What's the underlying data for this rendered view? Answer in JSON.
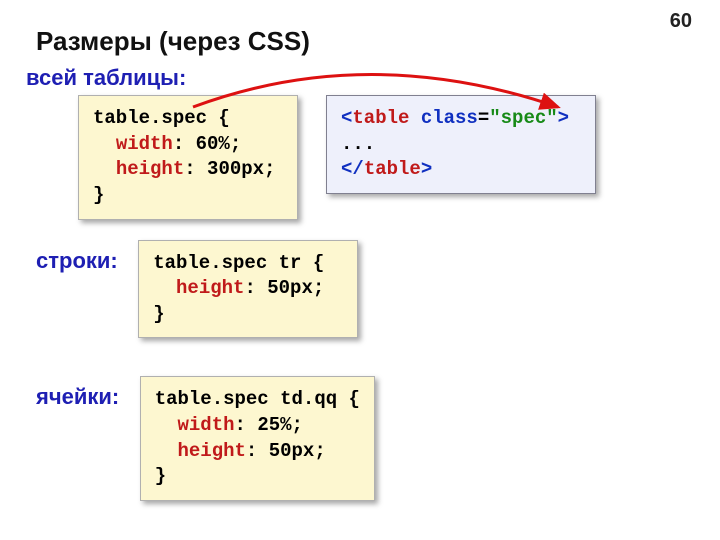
{
  "page_number": "60",
  "title": "Размеры (через CSS)",
  "labels": {
    "table": "всей таблицы:",
    "row": "строки:",
    "cell": "ячейки:"
  },
  "code": {
    "table_css": {
      "selector": "table.spec {",
      "width_key": "width",
      "width_val": ": 60%;",
      "height_key": "height",
      "height_val": ": 300px;",
      "close": "}"
    },
    "table_html": {
      "open_lt": "<",
      "open_tag": "table ",
      "attr": "class",
      "eq": "=",
      "val": "\"spec\"",
      "open_gt": ">",
      "body": "...",
      "close_lt": "</",
      "close_tag": "table",
      "close_gt": ">"
    },
    "row_css": {
      "selector": "table.spec tr {",
      "height_key": "height",
      "height_val": ": 50px;",
      "close": "}"
    },
    "cell_css": {
      "selector": "table.spec td.qq {",
      "width_key": "width",
      "width_val": ": 25%;",
      "height_key": "height",
      "height_val": ": 50px;",
      "close": "}"
    }
  }
}
